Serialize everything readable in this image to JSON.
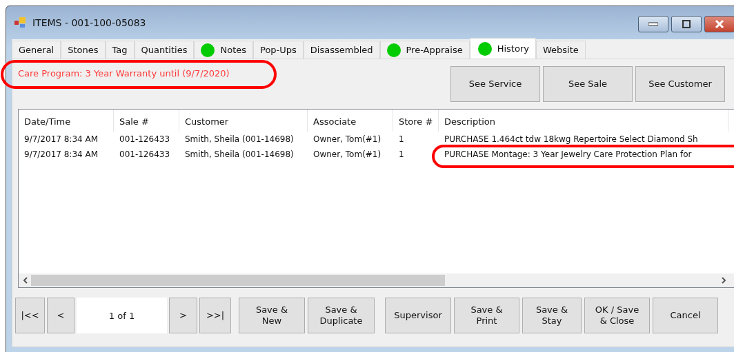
{
  "window": {
    "title": "ITEMS - 001-100-05083"
  },
  "tabs": [
    {
      "label": "General",
      "selected": false,
      "indicator": false
    },
    {
      "label": "Stones",
      "selected": false,
      "indicator": false
    },
    {
      "label": "Tag",
      "selected": false,
      "indicator": false
    },
    {
      "label": "Quantities",
      "selected": false,
      "indicator": false
    },
    {
      "label": "Notes",
      "selected": false,
      "indicator": true
    },
    {
      "label": "Pop-Ups",
      "selected": false,
      "indicator": false
    },
    {
      "label": "Disassembled",
      "selected": false,
      "indicator": false
    },
    {
      "label": "Pre-Appraise",
      "selected": false,
      "indicator": true
    },
    {
      "label": "History",
      "selected": true,
      "indicator": true
    },
    {
      "label": "Website",
      "selected": false,
      "indicator": false
    }
  ],
  "care_program": "Care Program: 3 Year Warranty until (9/7/2020)",
  "top_buttons": [
    "See Service",
    "See Sale",
    "See Customer"
  ],
  "table": {
    "columns": [
      "Date/Time",
      "Sale #",
      "Customer",
      "Associate",
      "Store #",
      "Description"
    ],
    "rows": [
      [
        "9/7/2017 8:34 AM",
        "001-126433",
        "Smith, Sheila (001-14698)",
        "Owner, Tom(#1)",
        "1",
        "PURCHASE 1.464ct tdw 18kwg Repertoire Select Diamond Sh"
      ],
      [
        "9/7/2017 8:34 AM",
        "001-126433",
        "Smith, Sheila (001-14698)",
        "Owner, Tom(#1)",
        "1",
        "PURCHASE Montage: 3 Year Jewelry Care Protection Plan for"
      ]
    ]
  },
  "pager": {
    "first": "|<<",
    "prev": "<",
    "page": "1 of 1",
    "next": ">",
    "last": ">>|"
  },
  "bottom_buttons": [
    "Save &\nNew",
    "Save &\nDuplicate",
    "Supervisor",
    "Save &\nPrint",
    "Save &\nStay",
    "OK / Save\n& Close",
    "Cancel"
  ]
}
